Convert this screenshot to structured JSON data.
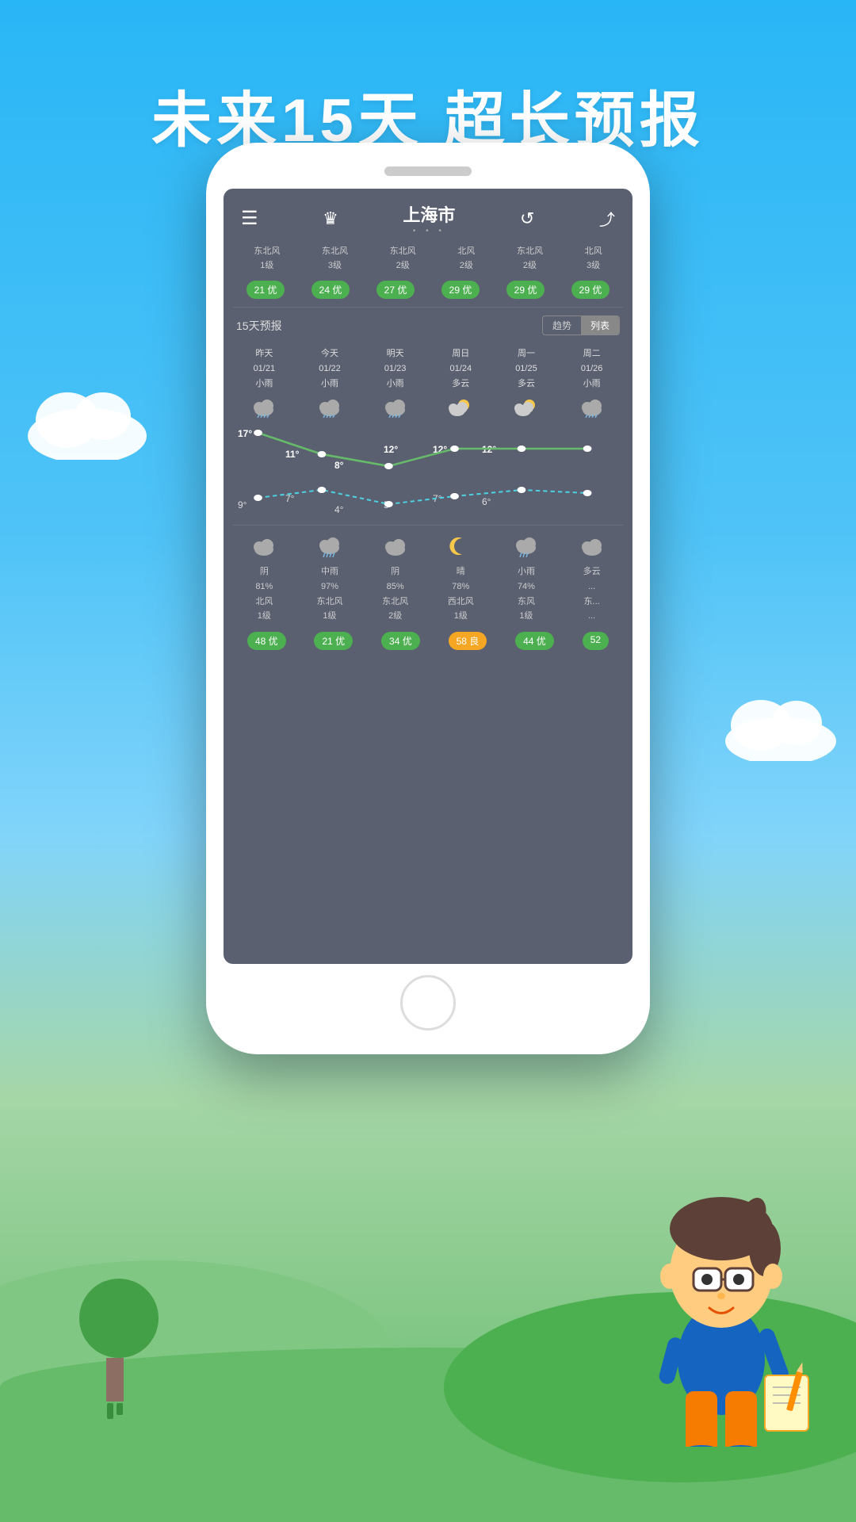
{
  "page": {
    "title": "未来15天  超长预报",
    "background_top": "#29b6f6",
    "background_bottom": "#66bb6a"
  },
  "phone": {
    "city": "上海市",
    "city_dots": "• • •"
  },
  "top_bar": {
    "menu_icon": "☰",
    "crown_icon": "♛",
    "refresh_icon": "↺",
    "share_icon": "⎋"
  },
  "wind_row": [
    {
      "wind": "东北风",
      "level": "1级",
      "aqi": "21 优"
    },
    {
      "wind": "东北风",
      "level": "3级",
      "aqi": "24 优"
    },
    {
      "wind": "东北风",
      "level": "2级",
      "aqi": "27 优"
    },
    {
      "wind": "北风",
      "level": "2级",
      "aqi": "29 优"
    },
    {
      "wind": "东北风",
      "level": "2级",
      "aqi": "29 优"
    },
    {
      "wind": "北风",
      "level": "3级",
      "aqi": "29 优"
    }
  ],
  "forecast_section": {
    "title": "15天预报",
    "btn_trend": "趋势",
    "btn_list": "列表"
  },
  "forecast_days": [
    {
      "label": "昨天",
      "date": "01/21",
      "weather": "小雨",
      "icon": "🌧",
      "high": "17°",
      "low": "9°",
      "night_icon": "☁",
      "night_weather": "阴",
      "humidity": "81%",
      "wind": "北风",
      "wind_level": "1级",
      "aqi": "48 优",
      "aqi_color": "green"
    },
    {
      "label": "今天",
      "date": "01/22",
      "weather": "小雨",
      "icon": "🌧",
      "high": "11°",
      "low": "7°",
      "night_icon": "🌧",
      "night_weather": "中雨",
      "humidity": "97%",
      "wind": "东北风",
      "wind_level": "1级",
      "aqi": "21 优",
      "aqi_color": "green"
    },
    {
      "label": "明天",
      "date": "01/23",
      "weather": "小雨",
      "icon": "🌧",
      "high": "8°",
      "low": "4°",
      "night_icon": "☁",
      "night_weather": "阴",
      "humidity": "85%",
      "wind": "东北风",
      "wind_level": "2级",
      "aqi": "34 优",
      "aqi_color": "green"
    },
    {
      "label": "周日",
      "date": "01/24",
      "weather": "多云",
      "icon": "⛅",
      "high": "12°",
      "low": "5°",
      "night_icon": "🌙",
      "night_weather": "晴",
      "humidity": "78%",
      "wind": "西北风",
      "wind_level": "1级",
      "aqi": "58 良",
      "aqi_color": "yellow"
    },
    {
      "label": "周一",
      "date": "01/25",
      "weather": "多云",
      "icon": "⛅",
      "high": "12°",
      "low": "7°",
      "night_icon": "🌧",
      "night_weather": "小雨",
      "humidity": "74%",
      "wind": "东风",
      "wind_level": "1级",
      "aqi": "44 优",
      "aqi_color": "green"
    },
    {
      "label": "周二",
      "date": "01/26",
      "weather": "小雨",
      "icon": "🌧",
      "high": "12°",
      "low": "6°",
      "night_icon": "☁",
      "night_weather": "多云",
      "humidity": "...",
      "wind": "东...",
      "wind_level": "...",
      "aqi": "52",
      "aqi_color": "green"
    }
  ]
}
